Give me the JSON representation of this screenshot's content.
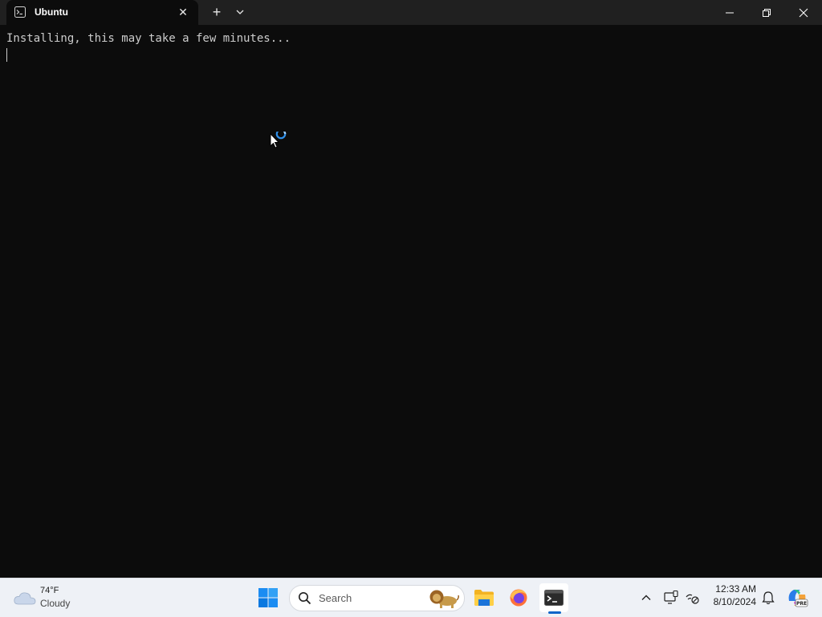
{
  "window": {
    "tab_title": "Ubuntu",
    "tab_close_glyph": "✕",
    "new_tab_glyph": "+",
    "icons": {
      "tab": "terminal-icon",
      "dropdown": "chevron-down-icon",
      "minimize": "minimize-icon",
      "maximize": "restore-icon",
      "close": "close-icon"
    }
  },
  "terminal": {
    "output_line": "Installing, this may take a few minutes...",
    "colors": {
      "background": "#0c0c0c",
      "text": "#cccccc"
    }
  },
  "cursor": {
    "state": "busy",
    "icon": "busy-pointer-icon"
  },
  "taskbar": {
    "weather": {
      "temperature": "74°F",
      "condition": "Cloudy",
      "icon": "cloud-icon"
    },
    "start_icon": "windows-start-icon",
    "search": {
      "label": "Search",
      "icon": "search-icon",
      "highlight_icon": "lion-icon"
    },
    "apps": [
      {
        "name": "File Explorer",
        "icon": "folder-icon"
      },
      {
        "name": "Firefox",
        "icon": "firefox-icon"
      },
      {
        "name": "Terminal",
        "icon": "terminal-icon",
        "active": true
      }
    ],
    "tray": {
      "chevron_icon": "chevron-up-icon",
      "monitor_icon": "monitor-icon",
      "network_icon": "network-icon",
      "time": "12:33 AM",
      "date": "8/10/2024",
      "bell_icon": "bell-icon",
      "copilot_icon": "copilot-icon",
      "copilot_badge": "PRE"
    }
  }
}
